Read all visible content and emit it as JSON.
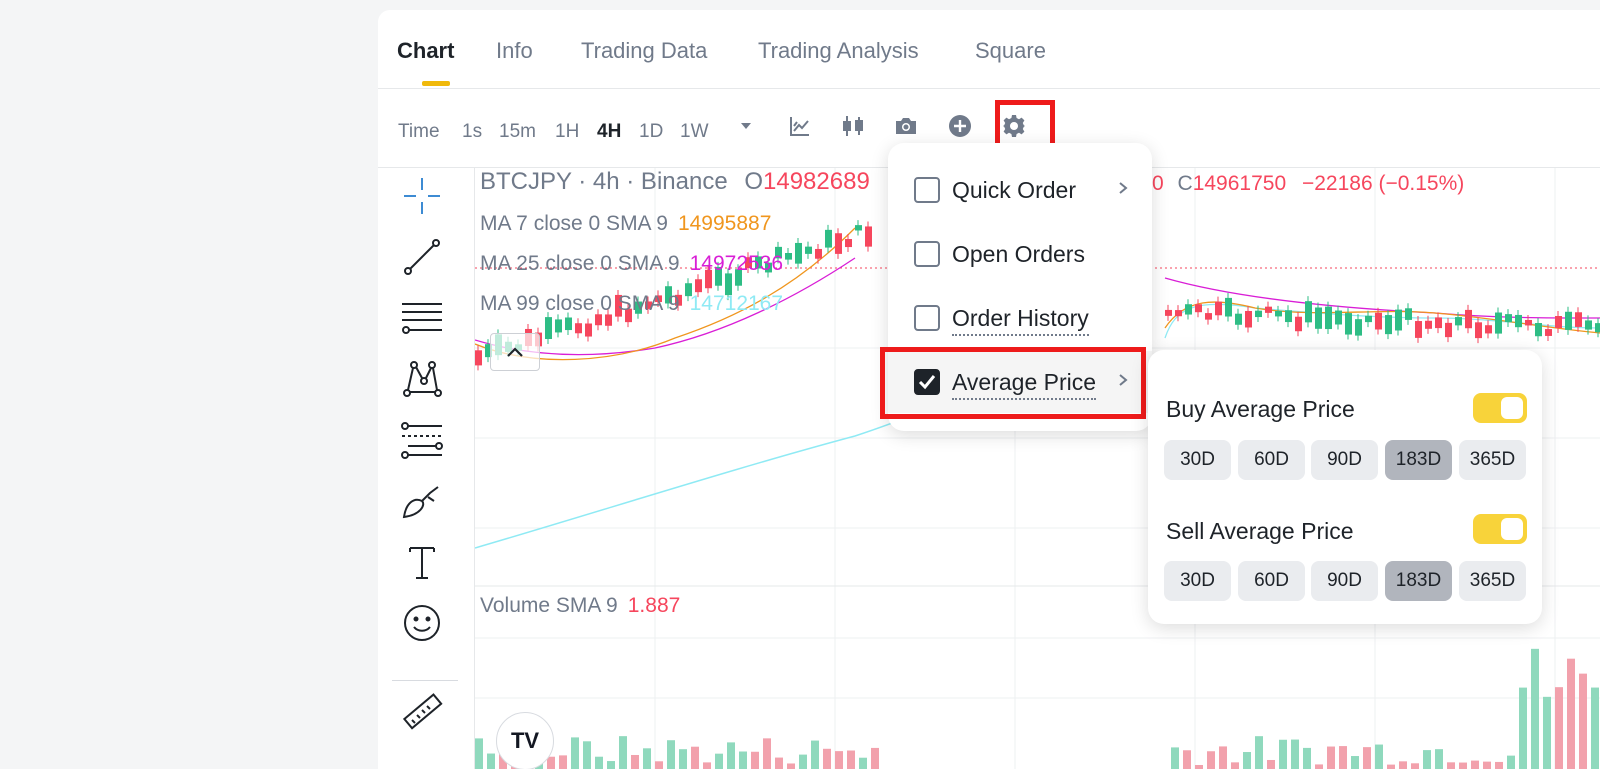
{
  "tabs": [
    {
      "label": "Chart",
      "active": true
    },
    {
      "label": "Info"
    },
    {
      "label": "Trading Data"
    },
    {
      "label": "Trading Analysis"
    },
    {
      "label": "Square"
    }
  ],
  "toolbar": {
    "time_label": "Time",
    "intervals": [
      "1s",
      "15m",
      "1H",
      "4H",
      "1D",
      "1W"
    ],
    "active_interval": "4H",
    "icons": [
      "chevron-down-icon",
      "indicators-icon",
      "candle-type-icon",
      "camera-icon",
      "add-icon",
      "gear-icon"
    ]
  },
  "drawing_tools": [
    "crosshair-icon",
    "trend-line-icon",
    "horizontal-lines-icon",
    "pattern-icon",
    "fib-icon",
    "brush-icon",
    "text-icon",
    "emoji-icon",
    "ruler-icon"
  ],
  "chart": {
    "symbol_line": "BTCJPY · 4h · Binance",
    "o_label": "O",
    "o_value": "14982689",
    "c_label": "C",
    "c_value": "14961750",
    "change": "−22186 (−0.15%)",
    "c_prefix_value": "0",
    "ma": [
      {
        "label": "MA 7 close 0 SMA 9",
        "value": "14995887",
        "color": "#f0961e"
      },
      {
        "label": "MA 25 close 0 SMA 9",
        "value": "14972536",
        "color": "#d91ed6"
      },
      {
        "label": "MA 99 close 0 SMA 9",
        "value": "14712167",
        "color": "#8feaf4"
      }
    ],
    "volume": {
      "label": "Volume SMA 9",
      "value": "1.887"
    },
    "colors": {
      "up": "#2ebd85",
      "down": "#f6465d",
      "up_vol": "#8fd9bd",
      "down_vol": "#f2a1ac"
    }
  },
  "settings_menu": {
    "items": [
      {
        "label": "Quick Order",
        "checked": false,
        "has_submenu": true
      },
      {
        "label": "Open Orders",
        "checked": false,
        "has_submenu": false
      },
      {
        "label": "Order History",
        "checked": false,
        "has_submenu": false
      },
      {
        "label": "Average Price",
        "checked": true,
        "has_submenu": true
      }
    ]
  },
  "average_price_submenu": {
    "buy": {
      "label": "Buy Average Price",
      "enabled": true,
      "periods": [
        "30D",
        "60D",
        "90D",
        "183D",
        "365D"
      ],
      "selected": "183D"
    },
    "sell": {
      "label": "Sell Average Price",
      "enabled": true,
      "periods": [
        "30D",
        "60D",
        "90D",
        "183D",
        "365D"
      ],
      "selected": "183D"
    }
  },
  "tradingview_logo": "TV",
  "accent": "#f0b90b",
  "highlight": "#ee1b1b"
}
